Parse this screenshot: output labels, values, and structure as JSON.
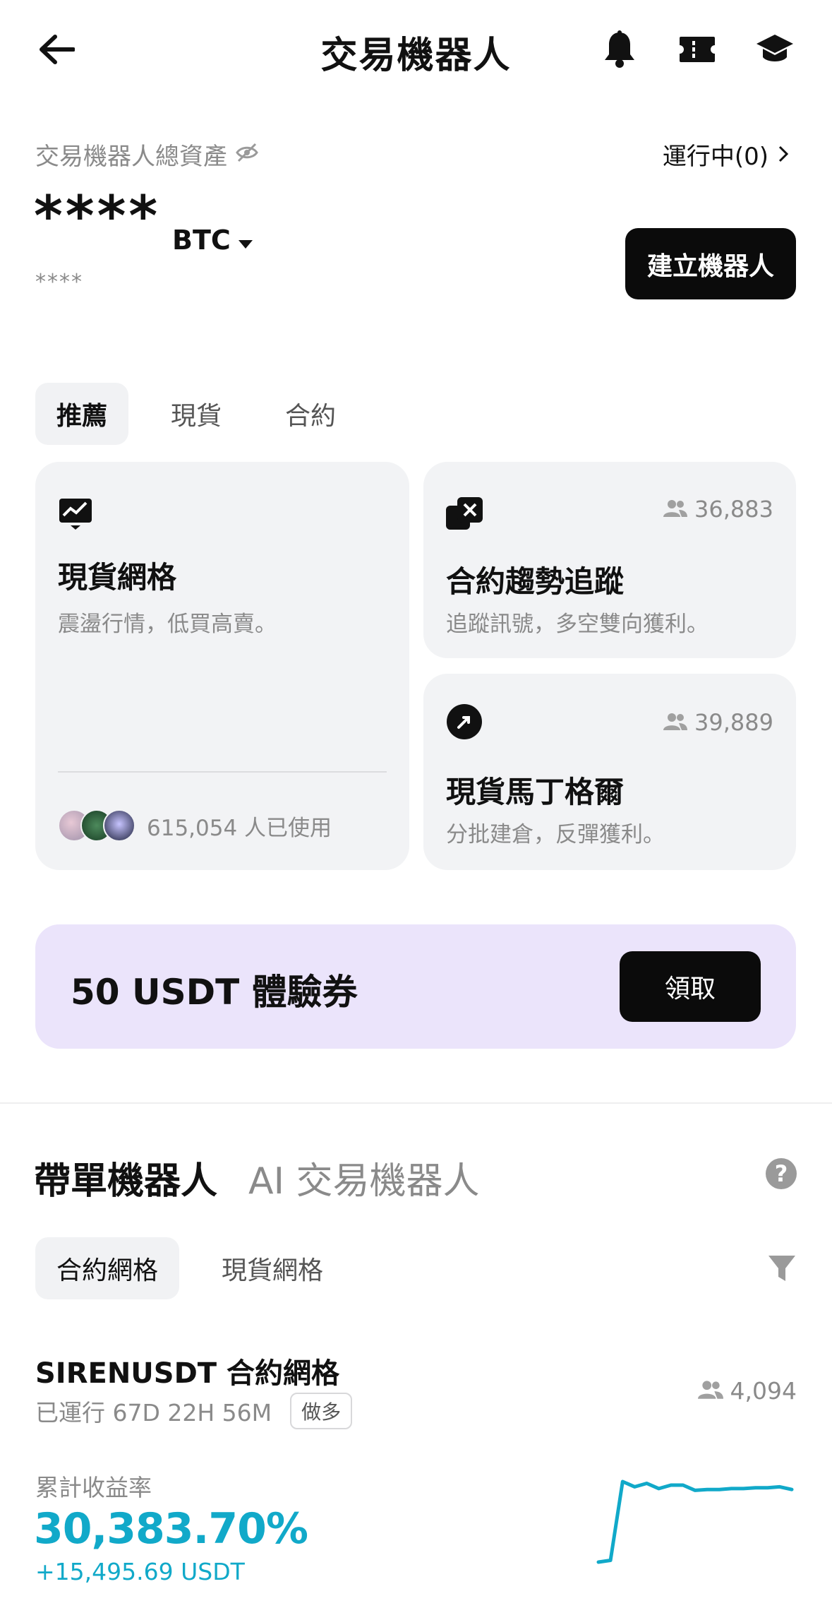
{
  "header": {
    "title": "交易機器人"
  },
  "assets": {
    "label": "交易機器人總資產",
    "running": "運行中(0)",
    "value": "****",
    "unit": "BTC",
    "sub_value": "****",
    "create_button": "建立機器人"
  },
  "category_tabs": [
    {
      "label": "推薦",
      "active": true
    },
    {
      "label": "現貨",
      "active": false
    },
    {
      "label": "合約",
      "active": false
    }
  ],
  "cards": {
    "spot_grid": {
      "title": "現貨網格",
      "description": "震盪行情，低買高賣。",
      "users_text": "615,054 人已使用"
    },
    "futures_trend": {
      "title": "合約趨勢追蹤",
      "description": "追蹤訊號，多空雙向獲利。",
      "users": "36,883"
    },
    "spot_martingale": {
      "title": "現貨馬丁格爾",
      "description": "分批建倉，反彈獲利。",
      "users": "39,889"
    }
  },
  "voucher": {
    "text": "50 USDT 體驗券",
    "button": "領取"
  },
  "section_tabs": [
    {
      "label": "帶單機器人",
      "active": true
    },
    {
      "label": "AI 交易機器人",
      "active": false
    }
  ],
  "sub_tabs": [
    {
      "label": "合約網格",
      "active": true
    },
    {
      "label": "現貨網格",
      "active": false
    }
  ],
  "bot": {
    "name": "SIRENUSDT 合約網格",
    "runtime": "已運行 67D 22H 56M",
    "tag": "做多",
    "users": "4,094",
    "roi_label": "累計收益率",
    "roi": "30,383.70%",
    "pnl": "+15,495.69 USDT",
    "sparkline": [
      0,
      2,
      92,
      86,
      90,
      84,
      88,
      88,
      82,
      83,
      83,
      84,
      84,
      85,
      85,
      86,
      83
    ]
  },
  "colors": {
    "accent": "#11a9c9",
    "voucher_bg": "#ebe4fb",
    "card_bg": "#f2f3f5"
  }
}
